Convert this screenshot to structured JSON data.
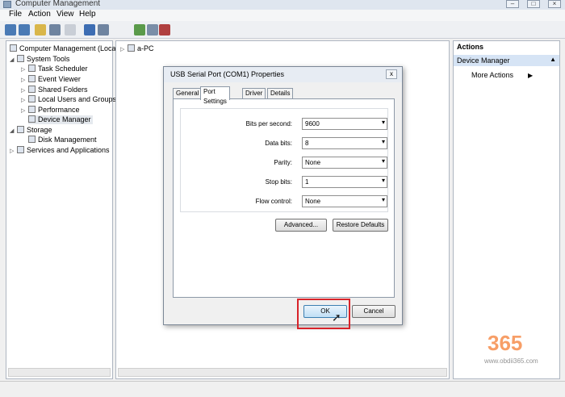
{
  "window": {
    "title": "Computer Management"
  },
  "menu": [
    "File",
    "Action",
    "View",
    "Help"
  ],
  "tree": {
    "items": [
      "Computer Management (Local",
      "System Tools",
      "Task Scheduler",
      "Event Viewer",
      "Shared Folders",
      "Local Users and Groups",
      "Performance",
      "Device Manager",
      "Storage",
      "Disk Management",
      "Services and Applications"
    ]
  },
  "center": {
    "node": "a-PC"
  },
  "actions": {
    "header": "Actions",
    "section": "Device Manager",
    "more": "More Actions"
  },
  "dialog": {
    "title": "USB Serial Port (COM1) Properties",
    "close": "x",
    "tabs": [
      "General",
      "Port Settings",
      "Driver",
      "Details"
    ],
    "fields": [
      {
        "label": "Bits per second:",
        "value": "9600"
      },
      {
        "label": "Data bits:",
        "value": "8"
      },
      {
        "label": "Parity:",
        "value": "None"
      },
      {
        "label": "Stop bits:",
        "value": "1"
      },
      {
        "label": "Flow control:",
        "value": "None"
      }
    ],
    "advanced": "Advanced...",
    "restore": "Restore Defaults",
    "ok": "OK",
    "cancel": "Cancel"
  },
  "watermark": {
    "text": "365",
    "url": "www.obdii365.com"
  }
}
